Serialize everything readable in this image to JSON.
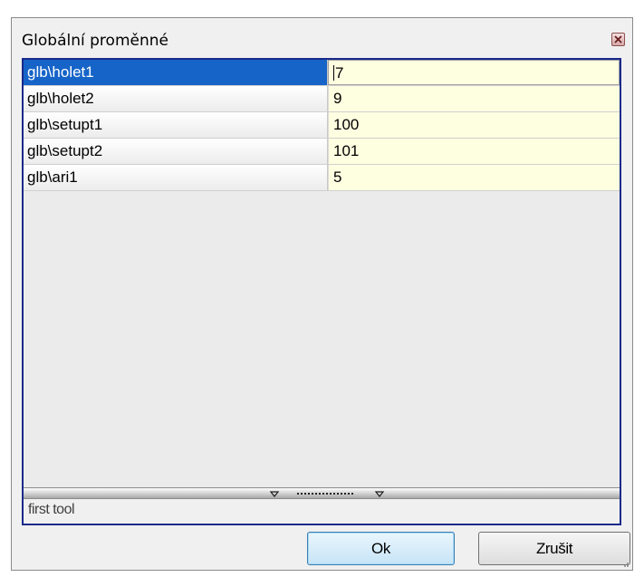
{
  "dialog": {
    "title": "Globální proměnné"
  },
  "variables": [
    {
      "name": "glb\\holet1",
      "value": "7",
      "selected": true
    },
    {
      "name": "glb\\holet2",
      "value": "9",
      "selected": false
    },
    {
      "name": "glb\\setupt1",
      "value": "100",
      "selected": false
    },
    {
      "name": "glb\\setupt2",
      "value": "101",
      "selected": false
    },
    {
      "name": "glb\\ari1",
      "value": "5",
      "selected": false
    }
  ],
  "description": "first tool",
  "buttons": {
    "ok_label": "Ok",
    "cancel_label": "Zrušit"
  },
  "colors": {
    "selection": "#1664c8",
    "value_cell": "#fefee0",
    "frame_border": "#1a2a8a"
  },
  "icons": {
    "close": "close-icon",
    "splitter": "splitter-grip-icon",
    "resize": "resize-grip-icon"
  }
}
